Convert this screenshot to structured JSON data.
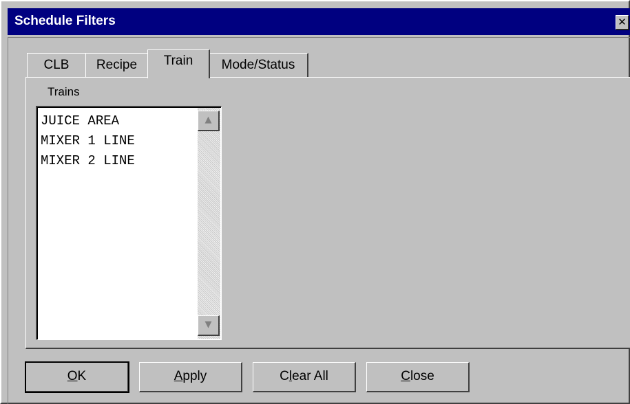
{
  "window": {
    "title": "Schedule Filters",
    "close_glyph": "✕"
  },
  "tabs": [
    {
      "label": "CLB",
      "active": false
    },
    {
      "label": "Recipe",
      "active": false
    },
    {
      "label": "Train",
      "active": true
    },
    {
      "label": "Mode/Status",
      "active": false
    }
  ],
  "trains": {
    "label": "Trains",
    "items": [
      "JUICE AREA",
      "MIXER 1 LINE",
      "MIXER 2 LINE"
    ],
    "scroll_up_glyph": "▲",
    "scroll_down_glyph": "▼"
  },
  "buttons": {
    "ok": {
      "accel": "O",
      "rest": "K"
    },
    "apply": {
      "accel": "A",
      "rest": "pply"
    },
    "clear_all": {
      "pre": "C",
      "accel": "l",
      "rest": "ear All"
    },
    "close": {
      "accel": "C",
      "rest": "lose"
    }
  },
  "colors": {
    "titlebar": "#000080",
    "face": "#c0c0c0"
  }
}
